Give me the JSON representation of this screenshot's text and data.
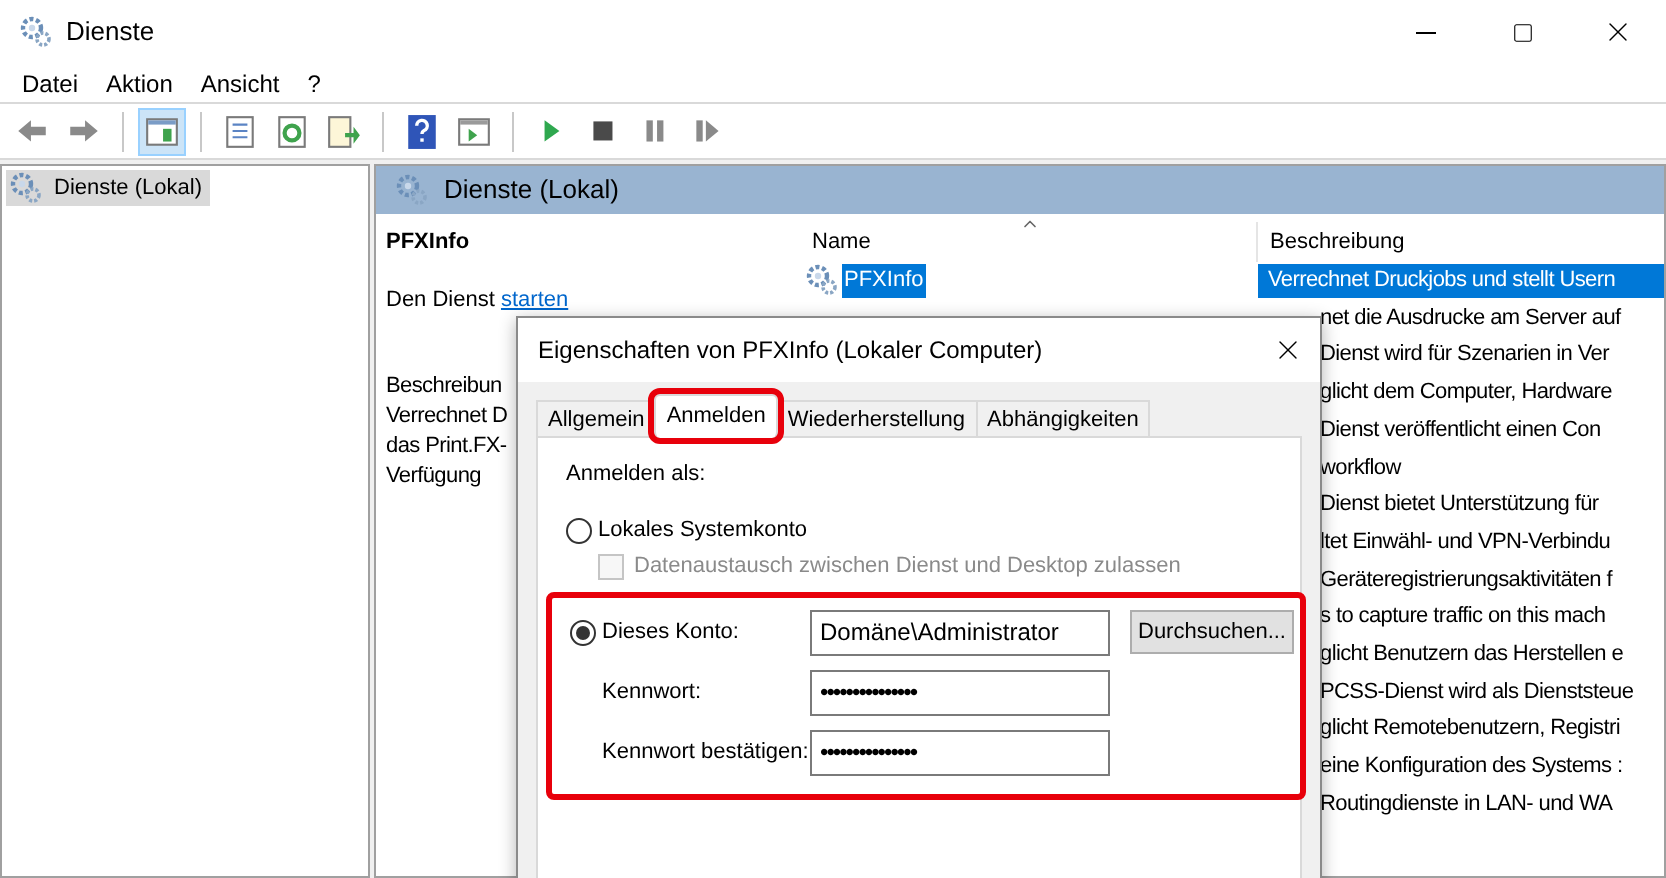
{
  "window": {
    "title": "Dienste"
  },
  "menu": [
    {
      "label": "Datei"
    },
    {
      "label": "Aktion"
    },
    {
      "label": "Ansicht"
    },
    {
      "label": "?"
    }
  ],
  "toolbar": [
    {
      "kind": "back"
    },
    {
      "kind": "forward"
    },
    {
      "kind": "sep"
    },
    {
      "kind": "pane",
      "pressed": true
    },
    {
      "kind": "sep"
    },
    {
      "kind": "props"
    },
    {
      "kind": "refresh"
    },
    {
      "kind": "export"
    },
    {
      "kind": "sep"
    },
    {
      "kind": "help"
    },
    {
      "kind": "view"
    },
    {
      "kind": "sep"
    },
    {
      "kind": "play"
    },
    {
      "kind": "stop"
    },
    {
      "kind": "pause"
    },
    {
      "kind": "resume"
    }
  ],
  "tree": [
    {
      "label": "Dienste (Lokal)",
      "selected": true
    }
  ],
  "pane": {
    "title": "Dienste (Lokal)",
    "service_name": "PFXInfo",
    "action_prefix": "Den Dienst ",
    "action_link": "starten",
    "description_lines": [
      "Beschreibun",
      "Verrechnet D",
      "das Print.FX-",
      "Verfügung"
    ]
  },
  "table": {
    "columns": [
      "Name",
      "Beschreibung"
    ],
    "rows": [
      {
        "name": "PFXInfo",
        "description": "Verrechnet Druckjobs und stellt Usern",
        "selected": true
      },
      {
        "description": "net die Ausdrucke am Server auf",
        "selected": false
      },
      {
        "description": "Dienst wird für Szenarien in Ver",
        "selected": false
      },
      {
        "description": "glicht dem Computer, Hardware",
        "selected": false
      },
      {
        "description": "Dienst veröffentlicht einen Con",
        "selected": false
      },
      {
        "description": "workflow",
        "selected": false
      },
      {
        "description": "Dienst bietet Unterstützung für",
        "selected": false
      },
      {
        "description": "ltet Einwähl- und VPN-Verbindu",
        "selected": false
      },
      {
        "description": "Geräteregistrierungsaktivitäten f",
        "selected": false
      },
      {
        "description": "s to capture traffic on this mach",
        "selected": false
      },
      {
        "description": "glicht Benutzern das Herstellen e",
        "selected": false
      },
      {
        "description": "PCSS-Dienst wird als Dienststeue",
        "selected": false
      },
      {
        "description": "glicht Remotebenutzern, Registri",
        "selected": false
      },
      {
        "description": "eine Konfiguration des Systems :",
        "selected": false
      },
      {
        "description": "Routingdienste in LAN- und WA",
        "selected": false
      }
    ]
  },
  "dialog": {
    "title": "Eigenschaften von PFXInfo (Lokaler Computer)",
    "tabs": [
      {
        "label": "Allgemein",
        "selected": false,
        "highlighted": false
      },
      {
        "label": "Anmelden",
        "selected": true,
        "highlighted": true
      },
      {
        "label": "Wiederherstellung",
        "selected": false,
        "highlighted": false
      },
      {
        "label": "Abhängigkeiten",
        "selected": false,
        "highlighted": false
      }
    ],
    "logon_label": "Anmelden als:",
    "local_system": {
      "label": "Lokales Systemkonto",
      "selected": false
    },
    "desktop_interaction": {
      "label": "Datenaustausch zwischen Dienst und Desktop zulassen",
      "checked": false,
      "disabled": true
    },
    "this_account": {
      "label": "Dieses Konto:",
      "selected": true,
      "value": "Domäne\\Administrator",
      "browse": "Durchsuchen...",
      "highlighted": true
    },
    "password": {
      "label": "Kennwort:",
      "value": "•••••••••••••••"
    },
    "confirm": {
      "label": "Kennwort bestätigen:",
      "value": "•••••••••••••••"
    }
  }
}
